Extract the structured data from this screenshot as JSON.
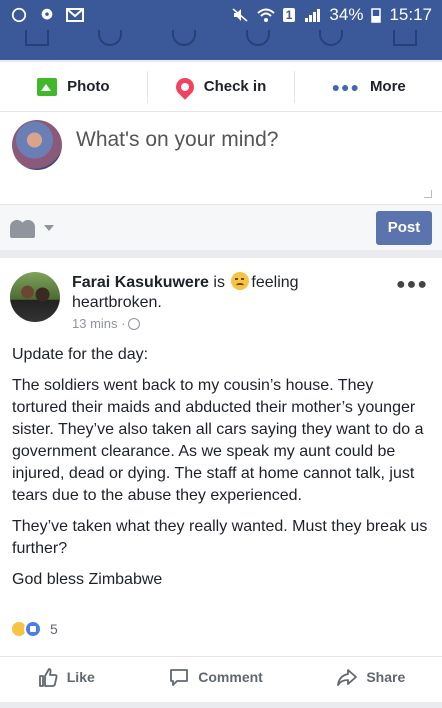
{
  "status_bar": {
    "battery": "34%",
    "time": "15:17",
    "sim_slot": "1"
  },
  "composer": {
    "actions": [
      {
        "label": "Photo",
        "icon": "photo-icon"
      },
      {
        "label": "Check in",
        "icon": "location-pin-icon"
      },
      {
        "label": "More",
        "icon": "more-dots-icon"
      }
    ],
    "placeholder": "What's on your mind?",
    "post_button": "Post"
  },
  "post": {
    "author": "Farai Kasukuwere",
    "is_word": "is",
    "feeling_label": "feeling",
    "feeling_value": "heartbroken.",
    "time": "13 mins ·",
    "paragraphs": [
      "Update for the day:",
      "The soldiers went back to my cousin’s house. They tortured their maids and abducted their mother’s younger sister. They’ve also taken all cars saying they want to do a government clearance. As we speak my aunt could be injured, dead or dying. The staff at home cannot talk, just tears due to the abuse they experienced.",
      "They’ve taken what they really wanted. Must they break us further?",
      "God bless Zimbabwe"
    ],
    "reaction_count": "5",
    "actions": {
      "like": "Like",
      "comment": "Comment",
      "share": "Share"
    }
  },
  "colors": {
    "brand_blue": "#3b5998",
    "post_button": "#5b74ad",
    "photo_green": "#42b72a",
    "pin_red": "#f3425f"
  }
}
